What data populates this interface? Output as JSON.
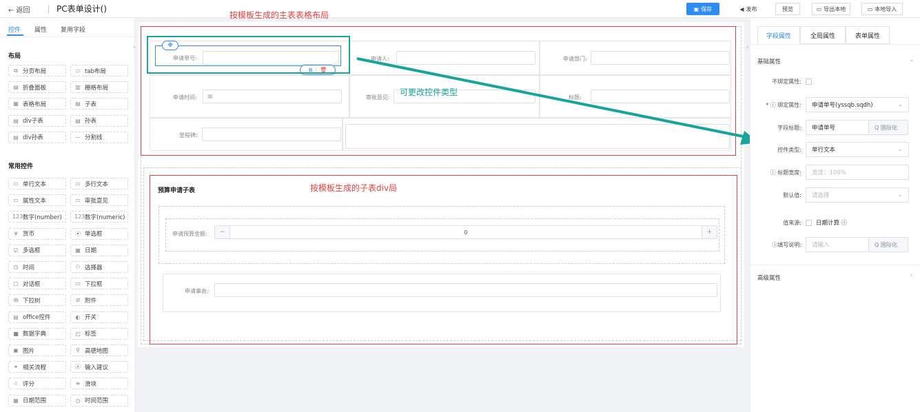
{
  "header": {
    "back": "← 返回",
    "title": "PC表单设计()",
    "save": "保存",
    "publish": "发布",
    "preview": "预览",
    "export": "导出本地",
    "import": "本地导入"
  },
  "left_tabs": [
    "控件",
    "属性",
    "复用字段"
  ],
  "sections": {
    "layout": "布局",
    "common": "常用控件"
  },
  "layout_widgets": [
    {
      "icon": "⧉",
      "label": "分页布局"
    },
    {
      "icon": "▭",
      "label": "tab布局"
    },
    {
      "icon": "▤",
      "label": "折叠面板"
    },
    {
      "icon": "▥",
      "label": "栅格布局"
    },
    {
      "icon": "▦",
      "label": "表格布局"
    },
    {
      "icon": "▤",
      "label": "子表"
    },
    {
      "icon": "▤",
      "label": "div子表"
    },
    {
      "icon": "▤",
      "label": "孙表"
    },
    {
      "icon": "▤",
      "label": "div孙表"
    },
    {
      "icon": "—",
      "label": "分割线"
    }
  ],
  "common_widgets": [
    {
      "icon": "▭",
      "label": "单行文本"
    },
    {
      "icon": "▭",
      "label": "多行文本"
    },
    {
      "icon": "▭",
      "label": "属性文本"
    },
    {
      "icon": "▭",
      "label": "审批意见"
    },
    {
      "icon": "123",
      "label": "数字(number)"
    },
    {
      "icon": "123",
      "label": "数字(numeric)"
    },
    {
      "icon": "¥",
      "label": "货币"
    },
    {
      "icon": "⦿",
      "label": "单选框"
    },
    {
      "icon": "☑",
      "label": "多选框"
    },
    {
      "icon": "▦",
      "label": "日期"
    },
    {
      "icon": "◷",
      "label": "时间"
    },
    {
      "icon": "⚇",
      "label": "选择器"
    },
    {
      "icon": "▢",
      "label": "对话框"
    },
    {
      "icon": "▭",
      "label": "下拉框"
    },
    {
      "icon": "⊞",
      "label": "下拉树"
    },
    {
      "icon": "⊘",
      "label": "附件"
    },
    {
      "icon": "▤",
      "label": "office控件"
    },
    {
      "icon": "◐",
      "label": "开关"
    },
    {
      "icon": "■",
      "label": "数据字典"
    },
    {
      "icon": "◰",
      "label": "标签"
    },
    {
      "icon": "▣",
      "label": "图片"
    },
    {
      "icon": "⚲",
      "label": "高德地图"
    },
    {
      "icon": "⚭",
      "label": "相关流程"
    },
    {
      "icon": "Ⓐ",
      "label": "输入建议"
    },
    {
      "icon": "☆",
      "label": "评分"
    },
    {
      "icon": "≡",
      "label": "滑块"
    },
    {
      "icon": "▦",
      "label": "日期范围"
    },
    {
      "icon": "◷",
      "label": "时间范围"
    }
  ],
  "annotations": {
    "main_table": "按模板生成的主表表格布局",
    "change_type": "可更改控件类型",
    "sub_table": "按模板生成的子表div局"
  },
  "main_form": {
    "f1": "申请单号:",
    "f2": "申请人:",
    "f3": "申请部门:",
    "f4": "申请时间:",
    "f5": "审批意见:",
    "f6": "标题:",
    "f7": "里程碑:"
  },
  "sub_form": {
    "title": "预算申请子表",
    "amount_label": "申请预算金额:",
    "amount_value": "0",
    "minus": "−",
    "plus": "+",
    "reason_label": "申请事由:"
  },
  "right_tabs": [
    "字段属性",
    "全局属性",
    "表单属性"
  ],
  "props": {
    "basic": "基础属性",
    "unbound": "不绑定属性:",
    "bind_label": "* ⓘ 绑定属性:",
    "bind_value": "申请单号(yssqb.sqdh)",
    "title_label": "字段标题:",
    "title_value": "申请单号",
    "i18n": "Q 国际化",
    "type_label": "控件类型:",
    "type_value": "单行文本",
    "width_label": "ⓘ 标题宽度:",
    "width_ph": "宽度：100%",
    "default_label": "默认值:",
    "default_ph": "请选择",
    "source_label": "值来源:",
    "source_value": "日期计算 ⓘ",
    "desc_label": "ⓘ填写说明:",
    "desc_ph": "请输入",
    "advanced": "高级属性"
  }
}
